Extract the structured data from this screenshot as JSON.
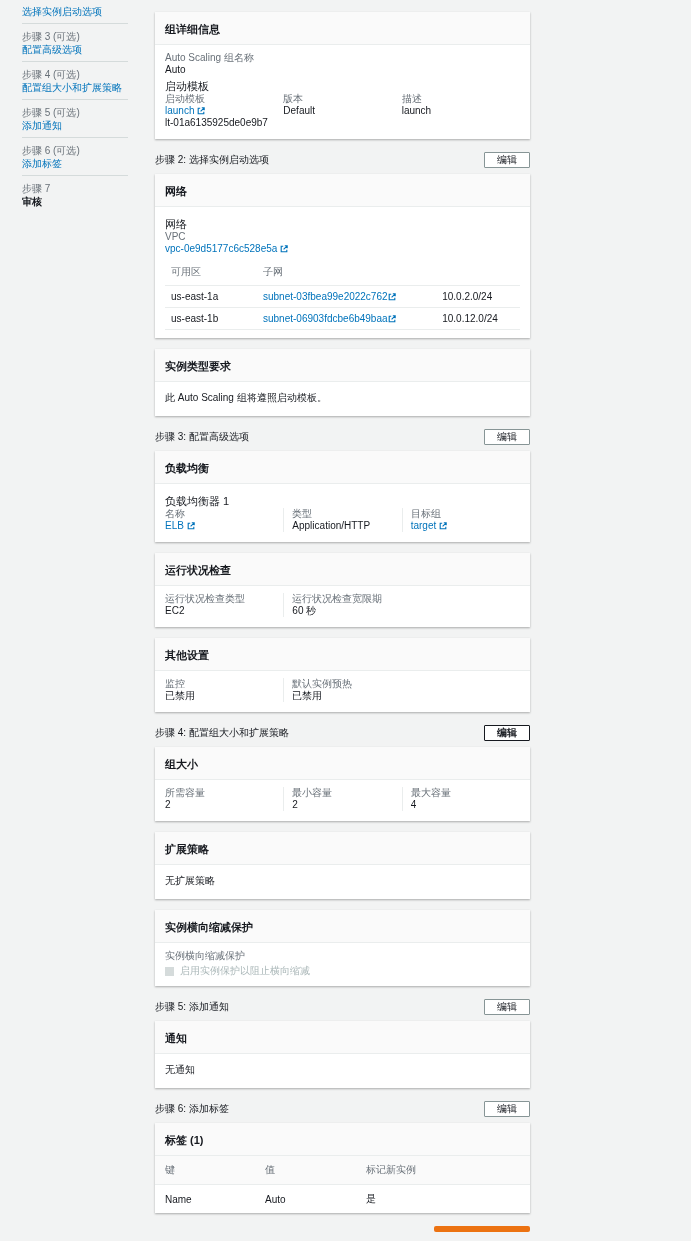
{
  "sidebar": {
    "steps": [
      {
        "title": "选择实例启动选项",
        "selected": false
      },
      {
        "label": "步骤 3 (可选)",
        "title": "配置高级选项",
        "selected": false
      },
      {
        "label": "步骤 4 (可选)",
        "title": "配置组大小和扩展策略",
        "selected": false
      },
      {
        "label": "步骤 5 (可选)",
        "title": "添加通知",
        "selected": false
      },
      {
        "label": "步骤 6 (可选)",
        "title": "添加标签",
        "selected": false
      },
      {
        "label": "步骤 7",
        "title": "审核",
        "selected": true
      }
    ]
  },
  "sections": [
    {
      "cards": [
        {
          "title": "组详细信息",
          "body": [
            {
              "kind": "fields",
              "fields": [
                {
                  "label": "Auto Scaling 组名称",
                  "value": "Auto",
                  "link": false
                }
              ]
            },
            {
              "kind": "subheading",
              "text": "启动模板"
            },
            {
              "kind": "fields",
              "divided": false,
              "fields": [
                {
                  "label": "启动模板",
                  "value": "launch",
                  "link": true,
                  "extra": "lt-01a6135925de0e9b7"
                },
                {
                  "label": "版本",
                  "value": "Default",
                  "link": false
                },
                {
                  "label": "描述",
                  "value": "launch",
                  "link": false
                }
              ]
            }
          ]
        }
      ]
    },
    {
      "heading": "步骤 2: 选择实例启动选项",
      "edit_button": {
        "label": "编辑",
        "focused": false
      },
      "cards": [
        {
          "title": "网络",
          "body": [
            {
              "kind": "subheading",
              "text": "网络"
            },
            {
              "kind": "fields",
              "fields": [
                {
                  "label": "VPC",
                  "value": "vpc-0e9d5177c6c528e5a",
                  "link": true
                }
              ]
            },
            {
              "kind": "table",
              "shaded_header": false,
              "columns": [
                "可用区",
                "子网"
              ],
              "rows": [
                [
                  {
                    "text": "us-east-1a",
                    "link": false
                  },
                  {
                    "text": "subnet-03fbea99e2022c762",
                    "link": true
                  },
                  {
                    "text": "10.0.2.0/24",
                    "link": false
                  }
                ],
                [
                  {
                    "text": "us-east-1b",
                    "link": false
                  },
                  {
                    "text": "subnet-06903fdcbe6b49baa",
                    "link": true
                  },
                  {
                    "text": "10.0.12.0/24",
                    "link": false
                  }
                ]
              ]
            }
          ]
        },
        {
          "title": "实例类型要求",
          "body": [
            {
              "kind": "text",
              "text": "此 Auto Scaling 组将遵照启动模板。"
            }
          ]
        }
      ]
    },
    {
      "heading": "步骤 3: 配置高级选项",
      "edit_button": {
        "label": "编辑",
        "focused": false
      },
      "cards": [
        {
          "title": "负载均衡",
          "body": [
            {
              "kind": "subheading",
              "text": "负载均衡器 1"
            },
            {
              "kind": "fields",
              "divided": true,
              "fields": [
                {
                  "label": "名称",
                  "value": "ELB",
                  "link": true
                },
                {
                  "label": "类型",
                  "value": "Application/HTTP",
                  "link": false
                },
                {
                  "label": "目标组",
                  "value": "target",
                  "link": true
                }
              ]
            }
          ]
        },
        {
          "title": "运行状况检查",
          "body": [
            {
              "kind": "fields",
              "divided": true,
              "fields": [
                {
                  "label": "运行状况检查类型",
                  "value": "EC2",
                  "link": false
                },
                {
                  "label": "运行状况检查宽限期",
                  "value": "60 秒",
                  "link": false
                }
              ]
            }
          ]
        },
        {
          "title": "其他设置",
          "body": [
            {
              "kind": "fields",
              "divided": true,
              "fields": [
                {
                  "label": "监控",
                  "value": "已禁用",
                  "link": false
                },
                {
                  "label": "默认实例预热",
                  "value": "已禁用",
                  "link": false
                }
              ]
            }
          ]
        }
      ]
    },
    {
      "heading": "步骤 4: 配置组大小和扩展策略",
      "edit_button": {
        "label": "编辑",
        "focused": true
      },
      "cards": [
        {
          "title": "组大小",
          "body": [
            {
              "kind": "fields",
              "divided": true,
              "fields": [
                {
                  "label": "所需容量",
                  "value": "2",
                  "link": false
                },
                {
                  "label": "最小容量",
                  "value": "2",
                  "link": false
                },
                {
                  "label": "最大容量",
                  "value": "4",
                  "link": false
                }
              ]
            }
          ]
        },
        {
          "title": "扩展策略",
          "body": [
            {
              "kind": "text",
              "text": "无扩展策略"
            }
          ]
        },
        {
          "title": "实例横向缩减保护",
          "body": [
            {
              "kind": "label",
              "text": "实例横向缩减保护"
            },
            {
              "kind": "checkbox",
              "text": "启用实例保护以阻止横向缩减",
              "checked": false,
              "disabled": true
            }
          ]
        }
      ]
    },
    {
      "heading": "步骤 5: 添加通知",
      "edit_button": {
        "label": "编辑",
        "focused": false
      },
      "cards": [
        {
          "title": "通知",
          "body": [
            {
              "kind": "text",
              "text": "无通知"
            }
          ]
        }
      ]
    },
    {
      "heading": "步骤 6: 添加标签",
      "edit_button": {
        "label": "编辑",
        "focused": false
      },
      "cards": [
        {
          "title": "标签 (1)",
          "body": [
            {
              "kind": "table",
              "shaded_header": true,
              "columns": [
                "键",
                "值",
                "标记新实例"
              ],
              "rows": [
                [
                  {
                    "text": "Name",
                    "link": false
                  },
                  {
                    "text": "Auto",
                    "link": false
                  },
                  {
                    "text": "是",
                    "link": false
                  }
                ]
              ]
            }
          ]
        }
      ]
    }
  ]
}
